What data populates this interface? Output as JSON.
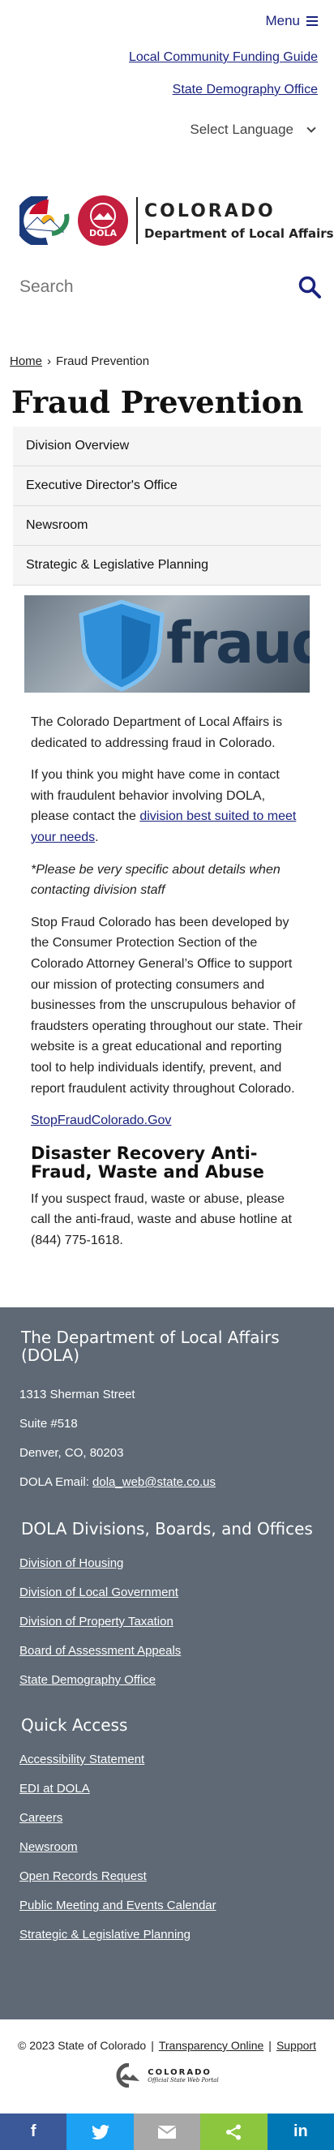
{
  "header": {
    "menu_label": "Menu",
    "top_links": [
      "Local Community Funding Guide",
      "State Demography Office"
    ],
    "language_label": "Select Language"
  },
  "logo": {
    "state_name": "COLORADO",
    "department": "Department of Local Affairs",
    "badge": "DOLA"
  },
  "search": {
    "placeholder": "Search"
  },
  "breadcrumb": {
    "home": "Home",
    "sep": "›",
    "current": "Fraud Prevention"
  },
  "page": {
    "title": "Fraud Prevention"
  },
  "side_nav": [
    "Division Overview",
    "Executive Director's Office",
    "Newsroom",
    "Strategic & Legislative Planning"
  ],
  "hero": {
    "word": "fraud"
  },
  "content": {
    "p1": "The Colorado Department of Local Affairs is dedicated to addressing fraud in Colorado.",
    "p2_before": "If you think you might have come in contact with fraudulent behavior involving DOLA, please contact the ",
    "p2_link": "division best suited to meet your needs",
    "p2_after": ".",
    "p3": "*Please be very specific about details when contacting division staff",
    "p4": "Stop Fraud Colorado has been developed by the Consumer Protection Section of the Colorado Attorney General’s Office to support our mission of protecting consumers and businesses from the unscrupulous behavior of fraudsters operating throughout our state. Their website is a great educational and reporting tool to help individuals identify, prevent, and report fraudulent activity throughout Colorado.",
    "p5_link": "StopFraudColorado.Gov",
    "h2": "Disaster Recovery Anti-Fraud, Waste and Abuse",
    "p6": "If you suspect fraud, waste or abuse, please call the anti-fraud, waste and abuse hotline at (844) 775-1618."
  },
  "footer": {
    "dept_title": "The Department of Local Affairs (DOLA)",
    "address": [
      "1313 Sherman Street",
      "Suite  #518",
      "Denver, CO, 80203"
    ],
    "email_label": "DOLA Email: ",
    "email": "dola_web@state.co.us",
    "divisions_title": "DOLA Divisions, Boards, and Offices",
    "divisions": [
      "Division of Housing",
      "Division of Local Government",
      "Division of Property Taxation",
      "Board of Assessment Appeals",
      "State Demography Office"
    ],
    "quick_title": "Quick Access",
    "quick": [
      "Accessibility Statement",
      "EDI at DOLA",
      "Careers",
      "Newsroom",
      "Open Records Request",
      "Public Meeting and Events Calendar",
      "Strategic & Legislative Planning"
    ]
  },
  "copyright": {
    "text": "© 2023 State of Colorado",
    "sep": "|",
    "link1": "Transparency Online",
    "link2": "Support",
    "portal_name": "COLORADO",
    "portal_sub": "Official State Web Portal"
  },
  "share": [
    {
      "icon": "facebook-icon",
      "glyph": "f",
      "color": "#3b5998"
    },
    {
      "icon": "twitter-icon",
      "glyph": "",
      "color": "#1da1f2"
    },
    {
      "icon": "email-icon",
      "glyph": "",
      "color": "#a8a8a8"
    },
    {
      "icon": "share-icon",
      "glyph": "",
      "color": "#8cc63f"
    },
    {
      "icon": "linkedin-icon",
      "glyph": "in",
      "color": "#0077b5"
    }
  ],
  "colors": {
    "link": "#1a237e",
    "footer_bg": "#5e6975",
    "badge_red": "#c41f3e"
  }
}
